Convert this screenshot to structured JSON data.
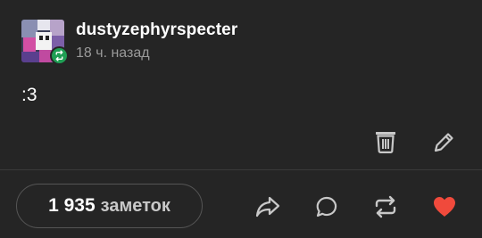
{
  "post": {
    "author": {
      "username": "dustyzephyrspecter",
      "avatar_icon": "avatar-image",
      "reblog_badge_icon": "reblog-icon"
    },
    "timestamp": "18 ч. назад",
    "content": ":3",
    "owner_actions": [
      {
        "name": "delete",
        "icon": "trash-icon"
      },
      {
        "name": "edit",
        "icon": "pencil-icon"
      }
    ],
    "notes": {
      "count": "1 935",
      "label": "заметок"
    },
    "footer_actions": [
      {
        "name": "share",
        "icon": "share-icon"
      },
      {
        "name": "reply",
        "icon": "comment-icon"
      },
      {
        "name": "reblog",
        "icon": "reblog-icon"
      },
      {
        "name": "like",
        "icon": "heart-icon",
        "state": "liked"
      }
    ]
  },
  "colors": {
    "background": "#252525",
    "text_primary": "#ffffff",
    "text_secondary": "#9a9a9a",
    "reblog_badge": "#1f9e54",
    "like_active": "#f04a3c",
    "icon": "#c8c8c8"
  }
}
